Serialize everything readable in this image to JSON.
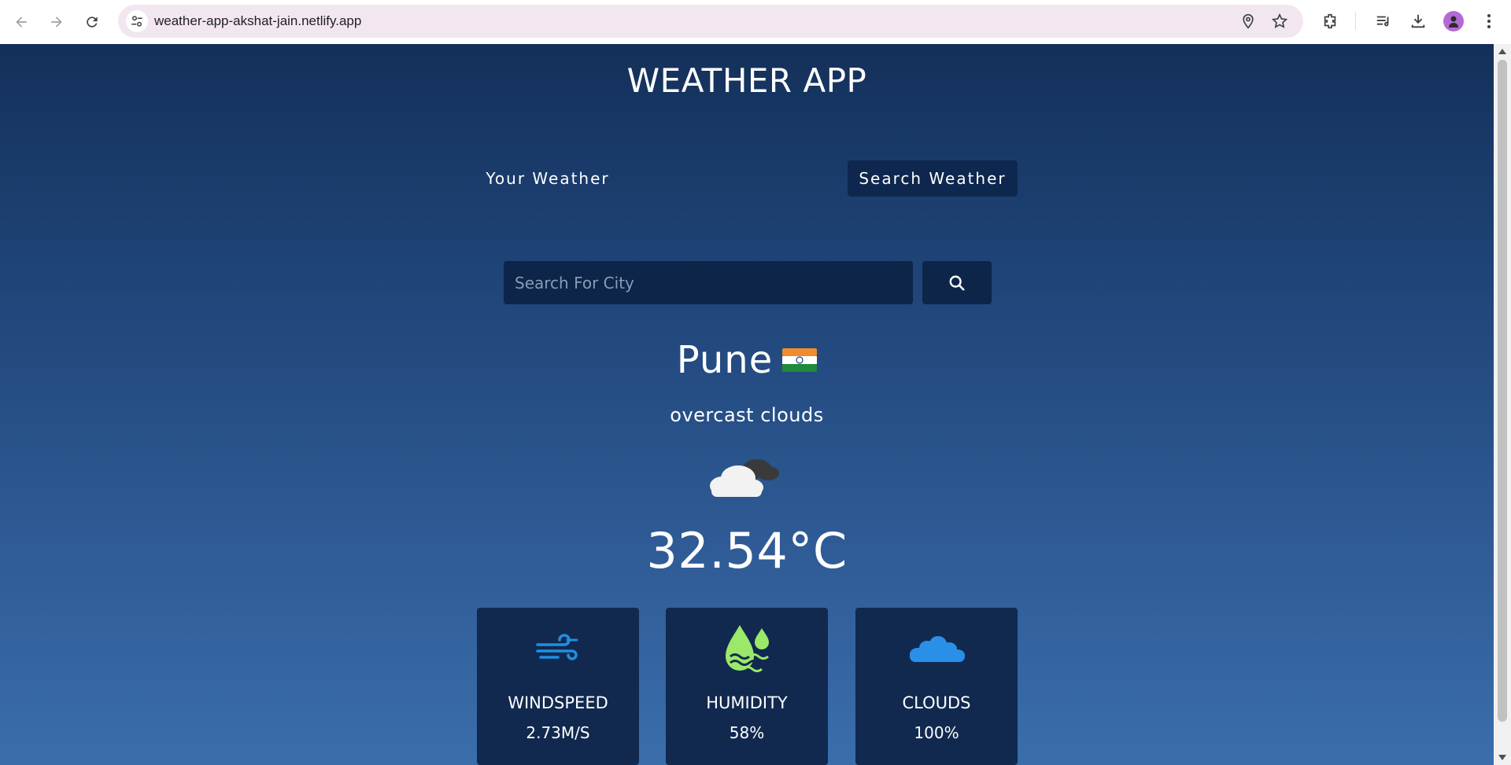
{
  "browser": {
    "url": "weather-app-akshat-jain.netlify.app"
  },
  "app": {
    "title": "WEATHER APP",
    "tabs": [
      {
        "label": "Your Weather",
        "active": false
      },
      {
        "label": "Search Weather",
        "active": true
      }
    ],
    "search": {
      "placeholder": "Search For City",
      "value": ""
    },
    "location": {
      "city": "Pune",
      "country_flag": "india-flag-icon"
    },
    "condition": "overcast clouds",
    "condition_icon": "overcast-clouds-icon",
    "temperature": "32.54°C",
    "stats": [
      {
        "label": "WINDSPEED",
        "value": "2.73M/S",
        "icon": "wind-icon"
      },
      {
        "label": "HUMIDITY",
        "value": "58%",
        "icon": "humidity-icon"
      },
      {
        "label": "CLOUDS",
        "value": "100%",
        "icon": "cloud-icon"
      }
    ]
  },
  "colors": {
    "background_top": "#14305a",
    "background_bottom": "#3a6eab",
    "card": "#11294f",
    "active_tab": "#0e274e",
    "wind_icon": "#1f8fe0",
    "humidity_icon": "#9be86a",
    "cloud_icon": "#2a8fe6"
  }
}
